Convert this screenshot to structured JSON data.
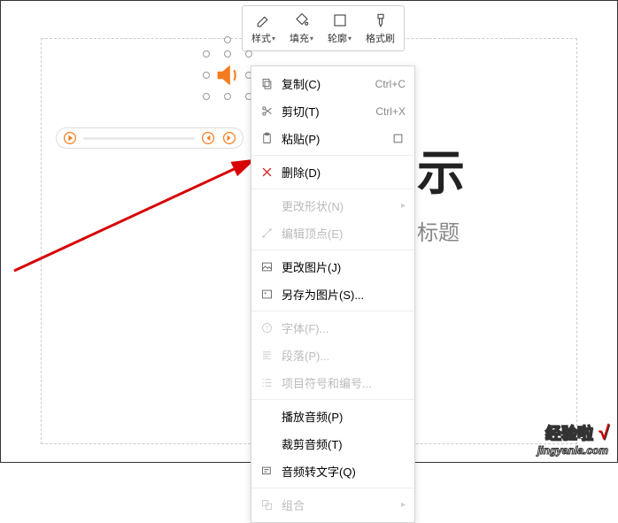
{
  "toolbar": {
    "style_label": "样式",
    "fill_label": "填充",
    "outline_label": "轮廓",
    "format_painter_label": "格式刷"
  },
  "slide": {
    "title_visible": "示",
    "subtitle_visible": "标题"
  },
  "context_menu": {
    "copy_label": "复制(C)",
    "copy_shortcut": "Ctrl+C",
    "cut_label": "剪切(T)",
    "cut_shortcut": "Ctrl+X",
    "paste_label": "粘贴(P)",
    "delete_label": "删除(D)",
    "change_shape_label": "更改形状(N)",
    "edit_points_label": "编辑顶点(E)",
    "change_picture_label": "更改图片(J)",
    "save_as_picture_label": "另存为图片(S)...",
    "font_label": "字体(F)...",
    "paragraph_label": "段落(P)...",
    "bullets_numbering_label": "项目符号和编号...",
    "play_audio_label": "播放音频(P)",
    "trim_audio_label": "裁剪音频(T)",
    "audio_to_text_label": "音频转文字(Q)",
    "group_label": "组合"
  },
  "watermark": {
    "text": "经验啦",
    "url": "jingyanla.com"
  }
}
